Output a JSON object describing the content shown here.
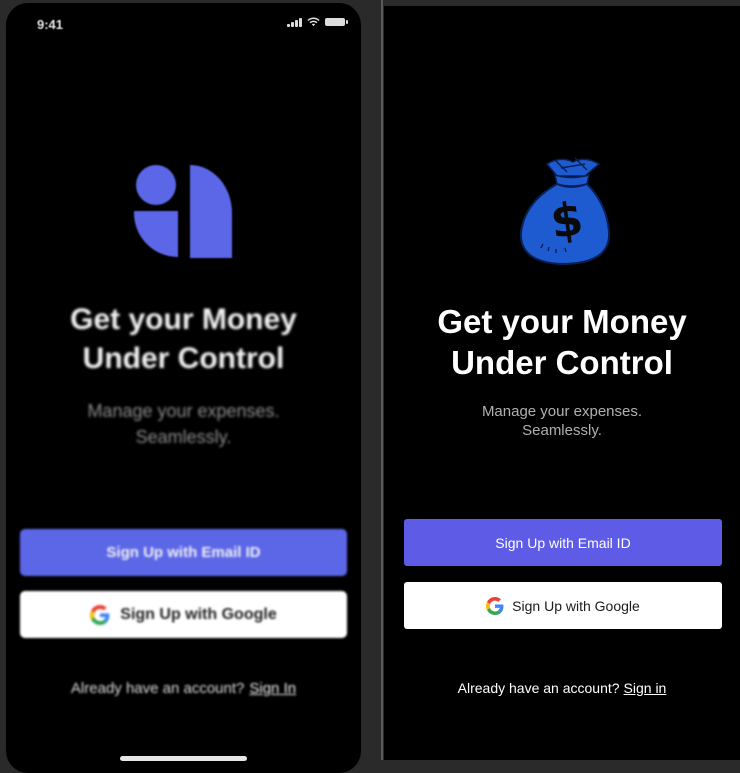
{
  "mockup": {
    "status_time": "9:41",
    "title_line1": "Get your Money",
    "title_line2": "Under Control",
    "subtitle_line1": "Manage your expenses.",
    "subtitle_line2": "Seamlessly.",
    "email_button": "Sign Up with Email ID",
    "google_button": "Sign Up with Google",
    "footer_text": "Already have an account?",
    "footer_link": "Sign In",
    "logo_icon": "app-logo-icon",
    "accent_color": "#5c67e8"
  },
  "app": {
    "title_line1": "Get your Money",
    "title_line2": "Under Control",
    "subtitle_line1": "Manage your expenses.",
    "subtitle_line2": "Seamlessly.",
    "email_button": "Sign Up with Email ID",
    "google_button": "Sign Up with Google",
    "footer_text": "Already have an account?",
    "footer_link": "Sign in",
    "logo_icon": "money-bag-icon",
    "accent_color": "#5e5ce6",
    "icon_color": "#1e5bd0"
  }
}
